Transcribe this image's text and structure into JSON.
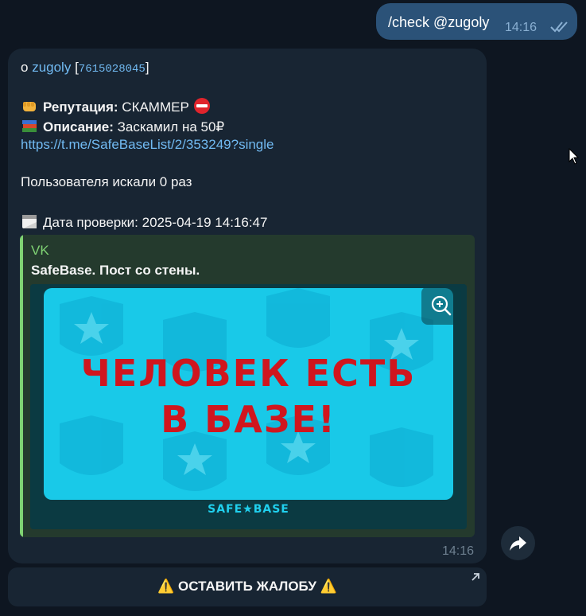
{
  "outgoing": {
    "text": "/check @zugoly",
    "time": "14:16",
    "status_icon": "double-check-icon"
  },
  "incoming": {
    "header": {
      "prefix": "о ",
      "username": "zugoly",
      "user_id": "7615028045"
    },
    "reputation": {
      "icon": "fist-emoji",
      "label": "Репутация:",
      "value": " СКАММЕР ",
      "badge_icon": "no-entry-emoji"
    },
    "description": {
      "icon": "books-emoji",
      "label": "Описание:",
      "value": " Заскамил на 50₽"
    },
    "link": "https://t.me/SafeBaseList/2/353249?single",
    "searched": "Пользователя искали 0 раз",
    "check_date": {
      "icon": "calendar-emoji",
      "text": "Дата проверки: 2025-04-19 14:16:47"
    },
    "preview": {
      "site": "VK",
      "title": "SafeBase. Пост со стены.",
      "poster_line1": "ЧЕЛОВЕК ЕСТЬ",
      "poster_line2": "В БАЗЕ!",
      "brand": "SAFE★BASE",
      "zoom_icon": "zoom-in-icon"
    },
    "time": "14:16"
  },
  "keyboard": {
    "button_label": "⚠️ ОСТАВИТЬ ЖАЛОБУ ⚠️",
    "corner_icon": "arrow-up-right-icon"
  },
  "share_icon": "share-arrow-icon",
  "colors": {
    "background": "#0e1621",
    "outgoing_bubble": "#2b5278",
    "incoming_bubble": "#182533",
    "link": "#71baf2",
    "preview_accent": "#7fd273",
    "poster_bg": "#19c9e8",
    "poster_text": "#d0161e"
  }
}
